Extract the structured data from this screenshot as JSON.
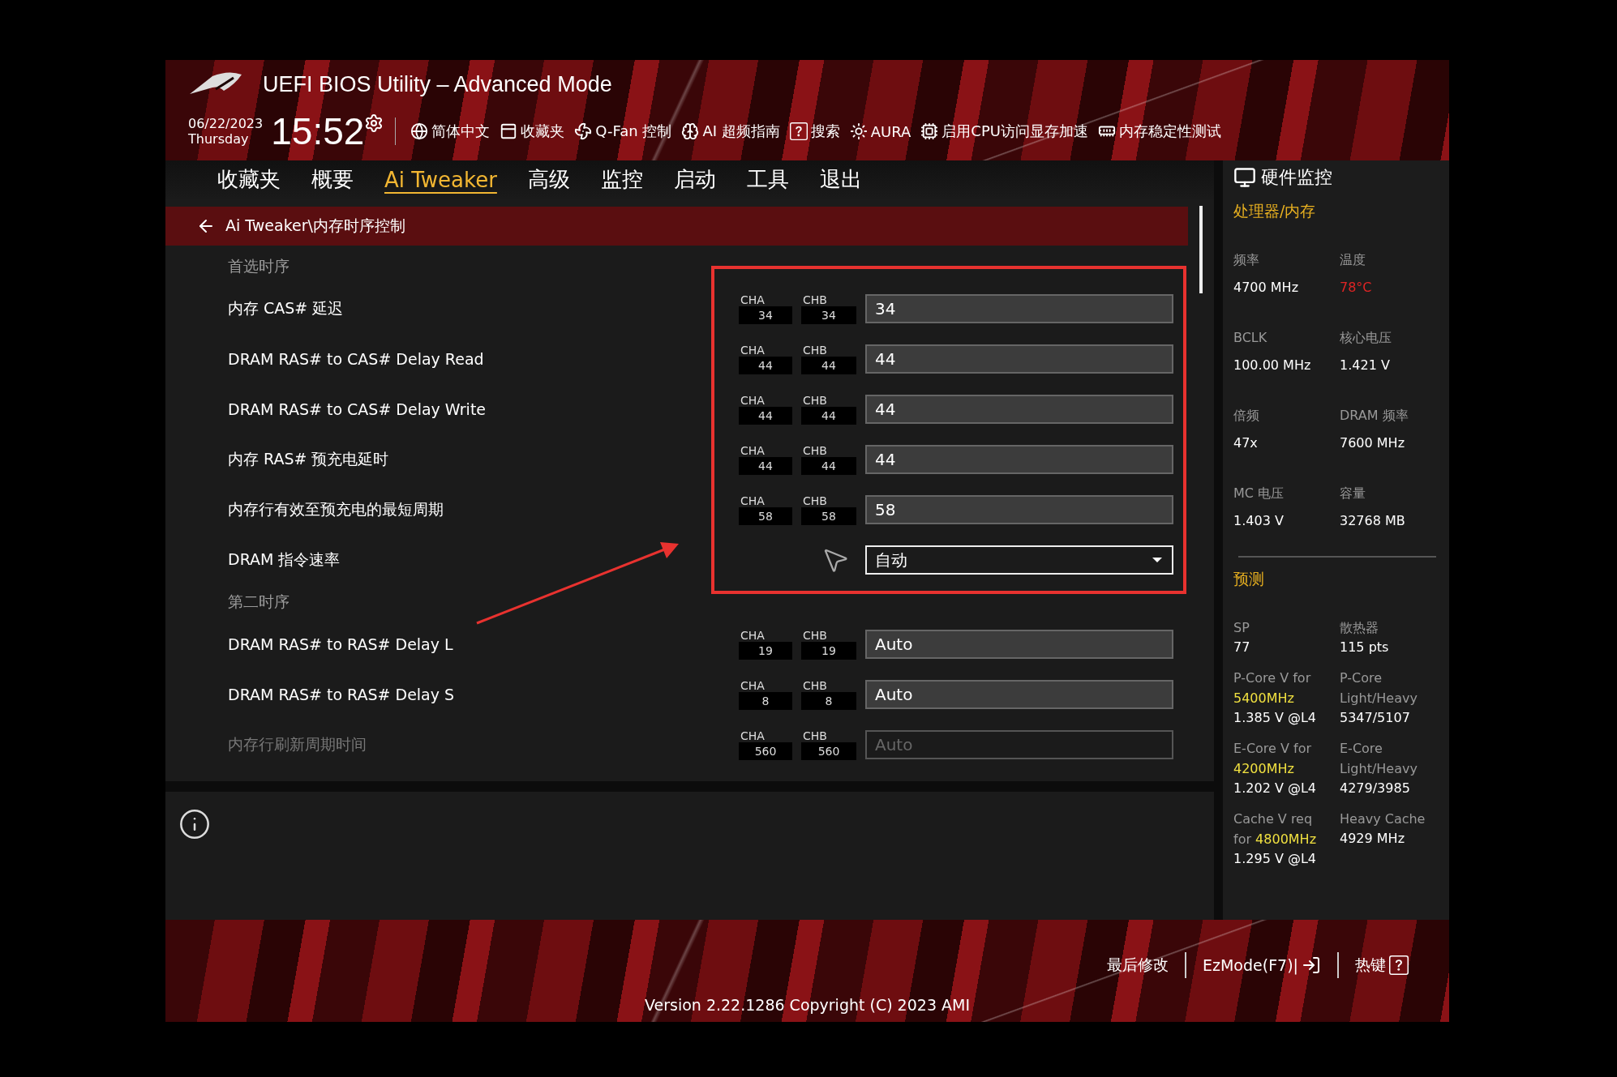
{
  "window": {
    "title": "UEFI BIOS Utility – Advanced Mode"
  },
  "header": {
    "date": "06/22/2023",
    "day": "Thursday",
    "time": "15:52",
    "tools": [
      "简体中文",
      "收藏夹",
      "Q-Fan 控制",
      "AI 超频指南",
      "搜索",
      "AURA",
      "启用CPU访问显存加速",
      "内存稳定性测试"
    ]
  },
  "tabs": [
    {
      "label": "收藏夹",
      "selected": false
    },
    {
      "label": "概要",
      "selected": false
    },
    {
      "label": "Ai Tweaker",
      "selected": true
    },
    {
      "label": "高级",
      "selected": false
    },
    {
      "label": "监控",
      "selected": false
    },
    {
      "label": "启动",
      "selected": false
    },
    {
      "label": "工具",
      "selected": false
    },
    {
      "label": "退出",
      "selected": false
    }
  ],
  "breadcrumb": "Ai Tweaker\\内存时序控制",
  "rows": [
    {
      "kind": "group",
      "label": "首选时序"
    },
    {
      "kind": "timing",
      "label": "内存 CAS# 延迟",
      "channels": [
        {
          "name": "CHA",
          "value": "34"
        },
        {
          "name": "CHB",
          "value": "34"
        }
      ],
      "value": "34",
      "disabled": false
    },
    {
      "kind": "timing",
      "label": "DRAM RAS# to CAS# Delay Read",
      "channels": [
        {
          "name": "CHA",
          "value": "44"
        },
        {
          "name": "CHB",
          "value": "44"
        }
      ],
      "value": "44",
      "disabled": false
    },
    {
      "kind": "timing",
      "label": "DRAM RAS# to CAS# Delay Write",
      "channels": [
        {
          "name": "CHA",
          "value": "44"
        },
        {
          "name": "CHB",
          "value": "44"
        }
      ],
      "value": "44",
      "disabled": false
    },
    {
      "kind": "timing",
      "label": "内存 RAS# 预充电延时",
      "channels": [
        {
          "name": "CHA",
          "value": "44"
        },
        {
          "name": "CHB",
          "value": "44"
        }
      ],
      "value": "44",
      "disabled": false
    },
    {
      "kind": "timing",
      "label": "内存行有效至预充电的最短周期",
      "channels": [
        {
          "name": "CHA",
          "value": "58"
        },
        {
          "name": "CHB",
          "value": "58"
        }
      ],
      "value": "58",
      "disabled": false
    },
    {
      "kind": "select",
      "label": "DRAM 指令速率",
      "value": "自动",
      "disabled": false
    },
    {
      "kind": "group",
      "label": "第二时序"
    },
    {
      "kind": "timing",
      "label": "DRAM RAS# to RAS# Delay L",
      "channels": [
        {
          "name": "CHA",
          "value": "19"
        },
        {
          "name": "CHB",
          "value": "19"
        }
      ],
      "value": "Auto",
      "disabled": false
    },
    {
      "kind": "timing",
      "label": "DRAM RAS# to RAS# Delay S",
      "channels": [
        {
          "name": "CHA",
          "value": "8"
        },
        {
          "name": "CHB",
          "value": "8"
        }
      ],
      "value": "Auto",
      "disabled": false
    },
    {
      "kind": "timing",
      "label": "内存行刷新周期时间",
      "channels": [
        {
          "name": "CHA",
          "value": "560"
        },
        {
          "name": "CHB",
          "value": "560"
        }
      ],
      "value": "Auto",
      "disabled": true
    }
  ],
  "monitor": {
    "title": "硬件监控",
    "sections": [
      {
        "title": "处理器/内存",
        "items": [
          {
            "label": "频率",
            "value": "4700 MHz",
            "alert": false
          },
          {
            "label": "温度",
            "value": "78°C",
            "alert": true
          },
          {
            "label": "BCLK",
            "value": "100.00 MHz",
            "alert": false
          },
          {
            "label": "核心电压",
            "value": "1.421 V",
            "alert": false
          },
          {
            "label": "倍频",
            "value": "47x",
            "alert": false
          },
          {
            "label": "DRAM 频率",
            "value": "7600 MHz",
            "alert": false
          },
          {
            "label": "MC 电压",
            "value": "1.403 V",
            "alert": false
          },
          {
            "label": "容量",
            "value": "32768 MB",
            "alert": false
          }
        ]
      },
      {
        "title": "预测",
        "items": [
          {
            "label": "SP",
            "value": "77",
            "alert": false
          },
          {
            "label": "散热器",
            "value": "115 pts",
            "alert": false
          },
          {
            "label": "P-Core V for",
            "highlight": "5400MHz",
            "value": "1.385 V @L4",
            "alert": false
          },
          {
            "label": "P-Core Light/Heavy",
            "value": "5347/5107",
            "alert": false
          },
          {
            "label": "E-Core V for",
            "highlight": "4200MHz",
            "value": "1.202 V @L4",
            "alert": false
          },
          {
            "label": "E-Core Light/Heavy",
            "value": "4279/3985",
            "alert": false
          },
          {
            "label": "Cache V req for",
            "highlight": "4800MHz",
            "value": "1.295 V @L4",
            "alert": false
          },
          {
            "label": "Heavy Cache",
            "value": "4929 MHz",
            "alert": false
          }
        ]
      }
    ]
  },
  "footer": {
    "actions": [
      "最后修改",
      "EzMode(F7)|",
      "热键"
    ],
    "version": "Version 2.22.1286 Copyright (C) 2023 AMI"
  }
}
